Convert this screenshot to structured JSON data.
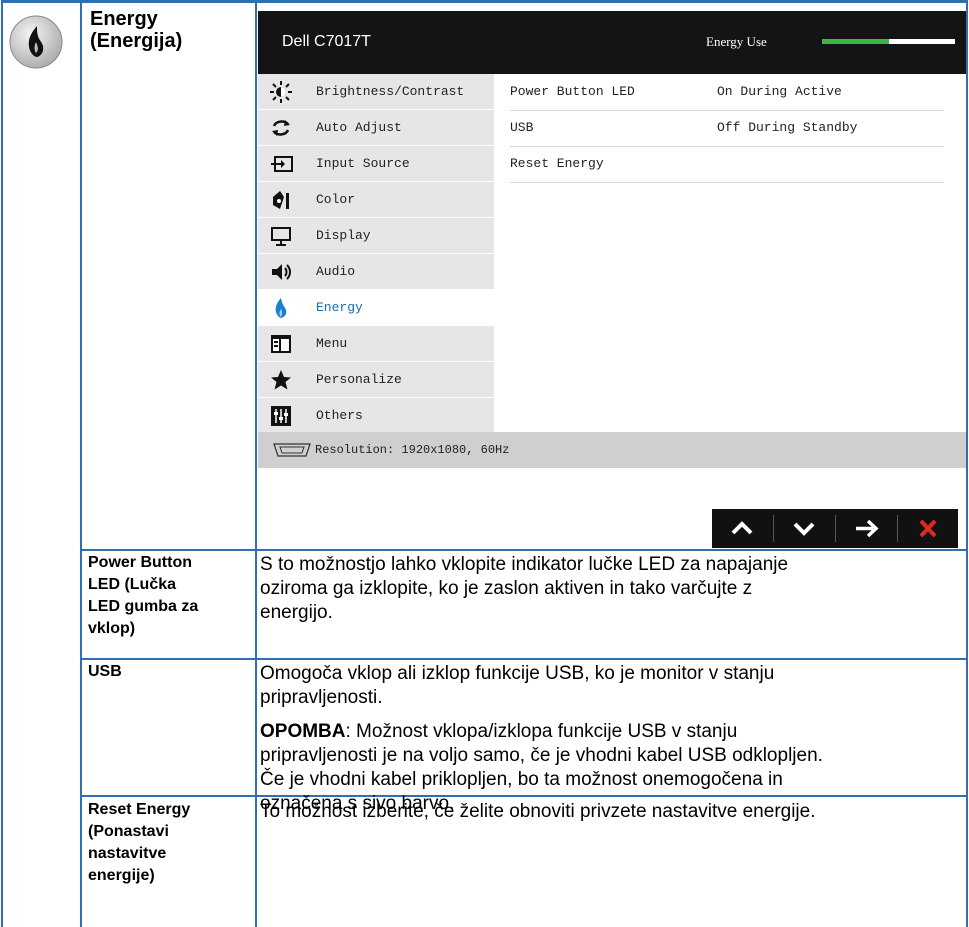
{
  "section": {
    "title_line1": "Energy",
    "title_line2": "(Energija)",
    "icon": "flame-icon"
  },
  "osd": {
    "model": "Dell C7017T",
    "energy_use_label": "Energy Use",
    "energy_use_level": 0.5,
    "accent_color": "#3cb54a",
    "menu": [
      {
        "label": "Brightness/Contrast",
        "icon": "brightness-icon"
      },
      {
        "label": "Auto Adjust",
        "icon": "auto-adjust-icon"
      },
      {
        "label": "Input Source",
        "icon": "input-source-icon"
      },
      {
        "label": "Color",
        "icon": "color-icon"
      },
      {
        "label": "Display",
        "icon": "display-icon"
      },
      {
        "label": "Audio",
        "icon": "audio-icon"
      },
      {
        "label": "Energy",
        "icon": "energy-icon",
        "active": true
      },
      {
        "label": "Menu",
        "icon": "menu-icon"
      },
      {
        "label": "Personalize",
        "icon": "star-icon"
      },
      {
        "label": "Others",
        "icon": "others-icon"
      }
    ],
    "options": [
      {
        "name": "Power Button LED",
        "value": "On During Active"
      },
      {
        "name": "USB",
        "value": "Off During Standby"
      },
      {
        "name": "Reset Energy",
        "value": ""
      }
    ],
    "resolution": "Resolution: 1920x1080, 60Hz",
    "nav": [
      "up-button",
      "down-button",
      "enter-button",
      "exit-button"
    ]
  },
  "rows": [
    {
      "label": [
        "Power Button",
        "LED (Lučka",
        "LED gumba za",
        "vklop)"
      ],
      "text": [
        "S to možnostjo lahko vklopite indikator lučke LED za napajanje",
        "oziroma ga izklopite, ko je zaslon aktiven in tako varčujte z",
        "energijo."
      ]
    },
    {
      "label": [
        "USB"
      ],
      "text": [
        "Omogoča vklop ali izklop funkcije USB, ko je monitor v stanju",
        "pripravljenosti."
      ],
      "note_bold": "OPOMBA",
      "note": [
        ": Možnost vklopa/izklopa funkcije USB v stanju",
        "pripravljenosti je na voljo samo, če je vhodni kabel USB odklopljen.",
        "Če je vhodni kabel priklopljen, bo ta možnost onemogočena in",
        "označena s sivo barvo."
      ]
    },
    {
      "label": [
        "Reset Energy",
        "(Ponastavi",
        "nastavitve",
        "energije)"
      ],
      "text": [
        "To možnost izberite, če želite obnoviti privzete nastavitve energije."
      ]
    }
  ]
}
